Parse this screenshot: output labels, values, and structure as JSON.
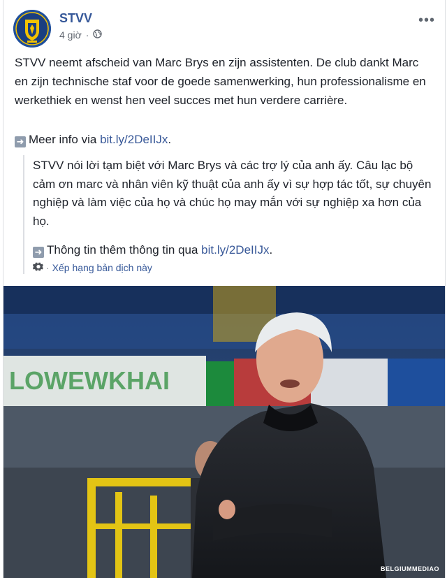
{
  "post": {
    "page_name": "STVV",
    "time": "4 giờ",
    "privacy_icon": "globe-icon",
    "more_label": "•••",
    "text": "STVV neemt afscheid van Marc Brys en zijn assistenten. De club dankt Marc en zijn technische staf voor de goede samenwerking, hun professionalisme en werkethiek en wenst hen veel succes met hun verdere carrière.",
    "more_info_label": "Meer info via",
    "more_info_link": "bit.ly/2DeIIJx",
    "more_info_suffix": ".",
    "translation": {
      "text": "STVV nói lời tạm biệt với Marc Brys và các trợ lý của anh ấy. Câu lạc bộ cảm ơn marc và nhân viên kỹ thuật của anh ấy vì sự hợp tác tốt, sự chuyên nghiệp và làm việc của họ và chúc họ may mắn với sự nghiệp xa hơn của họ.",
      "info_label": "Thông tin thêm thông tin qua",
      "info_link": "bit.ly/2DeIIJx",
      "info_suffix": ".",
      "rate_label": "Xếp hạng bản dịch này"
    },
    "photo": {
      "credit": "BELGIUMMEDIAO",
      "banner_text": "LOWEWKHAI"
    }
  },
  "colors": {
    "link": "#385898",
    "page_name": "#365899",
    "meta": "#616770"
  }
}
